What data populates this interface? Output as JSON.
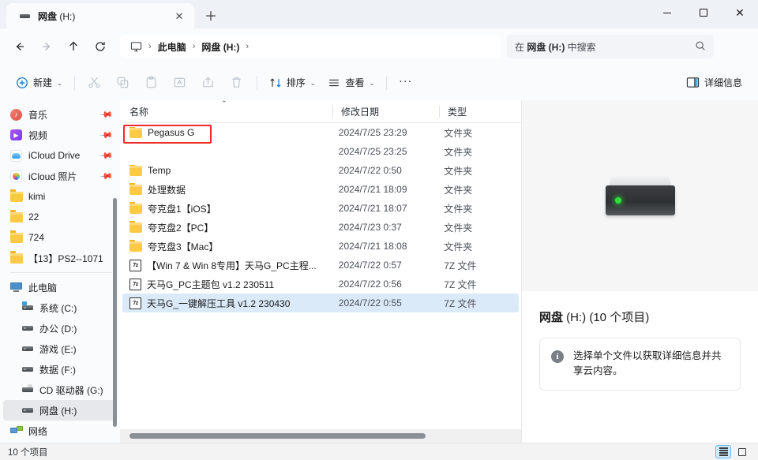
{
  "window": {
    "tab": {
      "title_bold": "网盘",
      "title_rest": " (H:)",
      "icon": "drive-icon",
      "close_glyph": "✕"
    },
    "new_tab_glyph": "＋",
    "controls": {
      "minimize": "—",
      "maximize": "▢",
      "close": "✕"
    }
  },
  "nav": {
    "back": "back-arrow",
    "forward": "forward-arrow",
    "up": "up-arrow",
    "refresh": "refresh-arrow",
    "breadcrumb": [
      {
        "label": "",
        "icon": "this-pc-icon"
      },
      {
        "label": "此电脑",
        "bold": true
      },
      {
        "label": "网盘 (H:)",
        "bold": true
      }
    ],
    "separator": "›"
  },
  "search": {
    "placeholder_prefix": "在 ",
    "placeholder_bold": "网盘 (H:)",
    "placeholder_suffix": " 中搜索",
    "icon": "search-icon"
  },
  "toolbar": {
    "new_label": "新建",
    "cut_label": "剪切",
    "copy_label": "复制",
    "paste_label": "粘贴",
    "rename_label": "重命名",
    "share_label": "共享",
    "delete_label": "删除",
    "sort_label": "排序",
    "view_label": "查看",
    "more_label": "···",
    "details_label": "详细信息",
    "caret": "⌄"
  },
  "sidebar": {
    "items": [
      {
        "label": "音乐",
        "icon": "music-icon",
        "pinned": true,
        "indent": 0
      },
      {
        "label": "视频",
        "icon": "video-icon",
        "pinned": true,
        "indent": 0
      },
      {
        "label": "iCloud Drive",
        "icon": "icloud-drive-icon",
        "pinned": true,
        "indent": 0
      },
      {
        "label": "iCloud 照片",
        "icon": "icloud-photos-icon",
        "pinned": true,
        "indent": 0
      },
      {
        "label": "kimi",
        "icon": "folder-icon",
        "pinned": false,
        "indent": 0
      },
      {
        "label": "22",
        "icon": "folder-icon",
        "pinned": false,
        "indent": 0
      },
      {
        "label": "724",
        "icon": "folder-icon",
        "pinned": false,
        "indent": 0
      },
      {
        "label": "【13】PS2--1071",
        "icon": "folder-icon",
        "pinned": false,
        "indent": 0
      }
    ],
    "items2": [
      {
        "label": "此电脑",
        "icon": "this-pc-icon",
        "indent": 0,
        "selected": false
      },
      {
        "label": "系统 (C:)",
        "icon": "system-drive-icon",
        "indent": 1,
        "selected": false
      },
      {
        "label": "办公 (D:)",
        "icon": "drive-icon",
        "indent": 1,
        "selected": false
      },
      {
        "label": "游戏 (E:)",
        "icon": "drive-icon",
        "indent": 1,
        "selected": false
      },
      {
        "label": "数据 (F:)",
        "icon": "drive-icon",
        "indent": 1,
        "selected": false
      },
      {
        "label": "CD 驱动器 (G:)",
        "icon": "cd-drive-icon",
        "indent": 1,
        "selected": false
      },
      {
        "label": "网盘 (H:)",
        "icon": "drive-icon",
        "indent": 1,
        "selected": true
      },
      {
        "label": "网络",
        "icon": "network-icon",
        "indent": 0,
        "selected": false
      }
    ]
  },
  "filelist": {
    "columns": [
      {
        "label": "名称",
        "key": "name"
      },
      {
        "label": "修改日期",
        "key": "date"
      },
      {
        "label": "类型",
        "key": "type"
      }
    ],
    "sort_indicator": "⌃",
    "rows": [
      {
        "name": "Pegasus G",
        "date": "2024/7/25 23:29",
        "type": "文件夹",
        "icon": "folder-icon",
        "selected": false,
        "highlight": true
      },
      {
        "name": "",
        "date": "2024/7/25 23:25",
        "type": "文件夹",
        "icon": "none",
        "selected": false,
        "highlight": false
      },
      {
        "name": "Temp",
        "date": "2024/7/22 0:50",
        "type": "文件夹",
        "icon": "folder-icon",
        "selected": false,
        "highlight": false
      },
      {
        "name": "处理数据",
        "date": "2024/7/21 18:09",
        "type": "文件夹",
        "icon": "folder-icon",
        "selected": false,
        "highlight": false
      },
      {
        "name": "夸克盘1【iOS】",
        "date": "2024/7/21 18:07",
        "type": "文件夹",
        "icon": "folder-icon",
        "selected": false,
        "highlight": false
      },
      {
        "name": "夸克盘2【PC】",
        "date": "2024/7/23 0:37",
        "type": "文件夹",
        "icon": "folder-icon",
        "selected": false,
        "highlight": false
      },
      {
        "name": "夸克盘3【Mac】",
        "date": "2024/7/21 18:08",
        "type": "文件夹",
        "icon": "folder-icon",
        "selected": false,
        "highlight": false
      },
      {
        "name": "【Win 7 & Win 8专用】天马G_PC主程...",
        "date": "2024/7/22 0:57",
        "type": "7Z 文件",
        "icon": "7z-icon",
        "selected": false,
        "highlight": false
      },
      {
        "name": "天马G_PC主题包 v1.2 230511",
        "date": "2024/7/22 0:56",
        "type": "7Z 文件",
        "icon": "7z-icon",
        "selected": false,
        "highlight": false
      },
      {
        "name": "天马G_一键解压工具  v1.2 230430",
        "date": "2024/7/22 0:55",
        "type": "7Z 文件",
        "icon": "7z-icon",
        "selected": true,
        "highlight": false
      }
    ],
    "highlight_color": "#ec2b2b"
  },
  "details": {
    "preview_icon": "drive-large-icon",
    "title_bold": "网盘",
    "title_rest": " (H:) (10 个项目)",
    "info_icon": "info-icon",
    "info_text": "选择单个文件以获取详细信息并共享云内容。"
  },
  "statusbar": {
    "item_count": "10 个项目",
    "view_details_icon": "details-view-icon",
    "view_large_icon": "large-icons-view-icon"
  }
}
